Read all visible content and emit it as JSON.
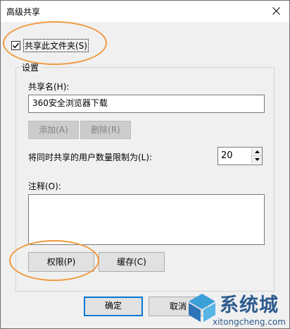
{
  "window": {
    "title": "高级共享",
    "close_icon": "close-icon"
  },
  "share": {
    "checkbox_label": "共享此文件夹(S)",
    "checked": true
  },
  "settings": {
    "group_title": "设置",
    "share_name_label": "共享名(H):",
    "share_name_value": "360安全浏览器下载",
    "add_label": "添加(A)",
    "remove_label": "删除(R)",
    "limit_label": "将同时共享的用户数量限制为(L):",
    "limit_value": "20",
    "comment_label": "注释(O):",
    "comment_value": "",
    "permissions_label": "权限(P)",
    "cache_label": "缓存(C)"
  },
  "footer": {
    "ok_label": "确定",
    "cancel_label": "取消"
  },
  "watermark": {
    "brand": "系统城",
    "url": "xitongcheng.com"
  },
  "colors": {
    "highlight_ellipse": "#ef9a3e",
    "focus_border": "#0078d7",
    "watermark": "#2d5b8e"
  }
}
